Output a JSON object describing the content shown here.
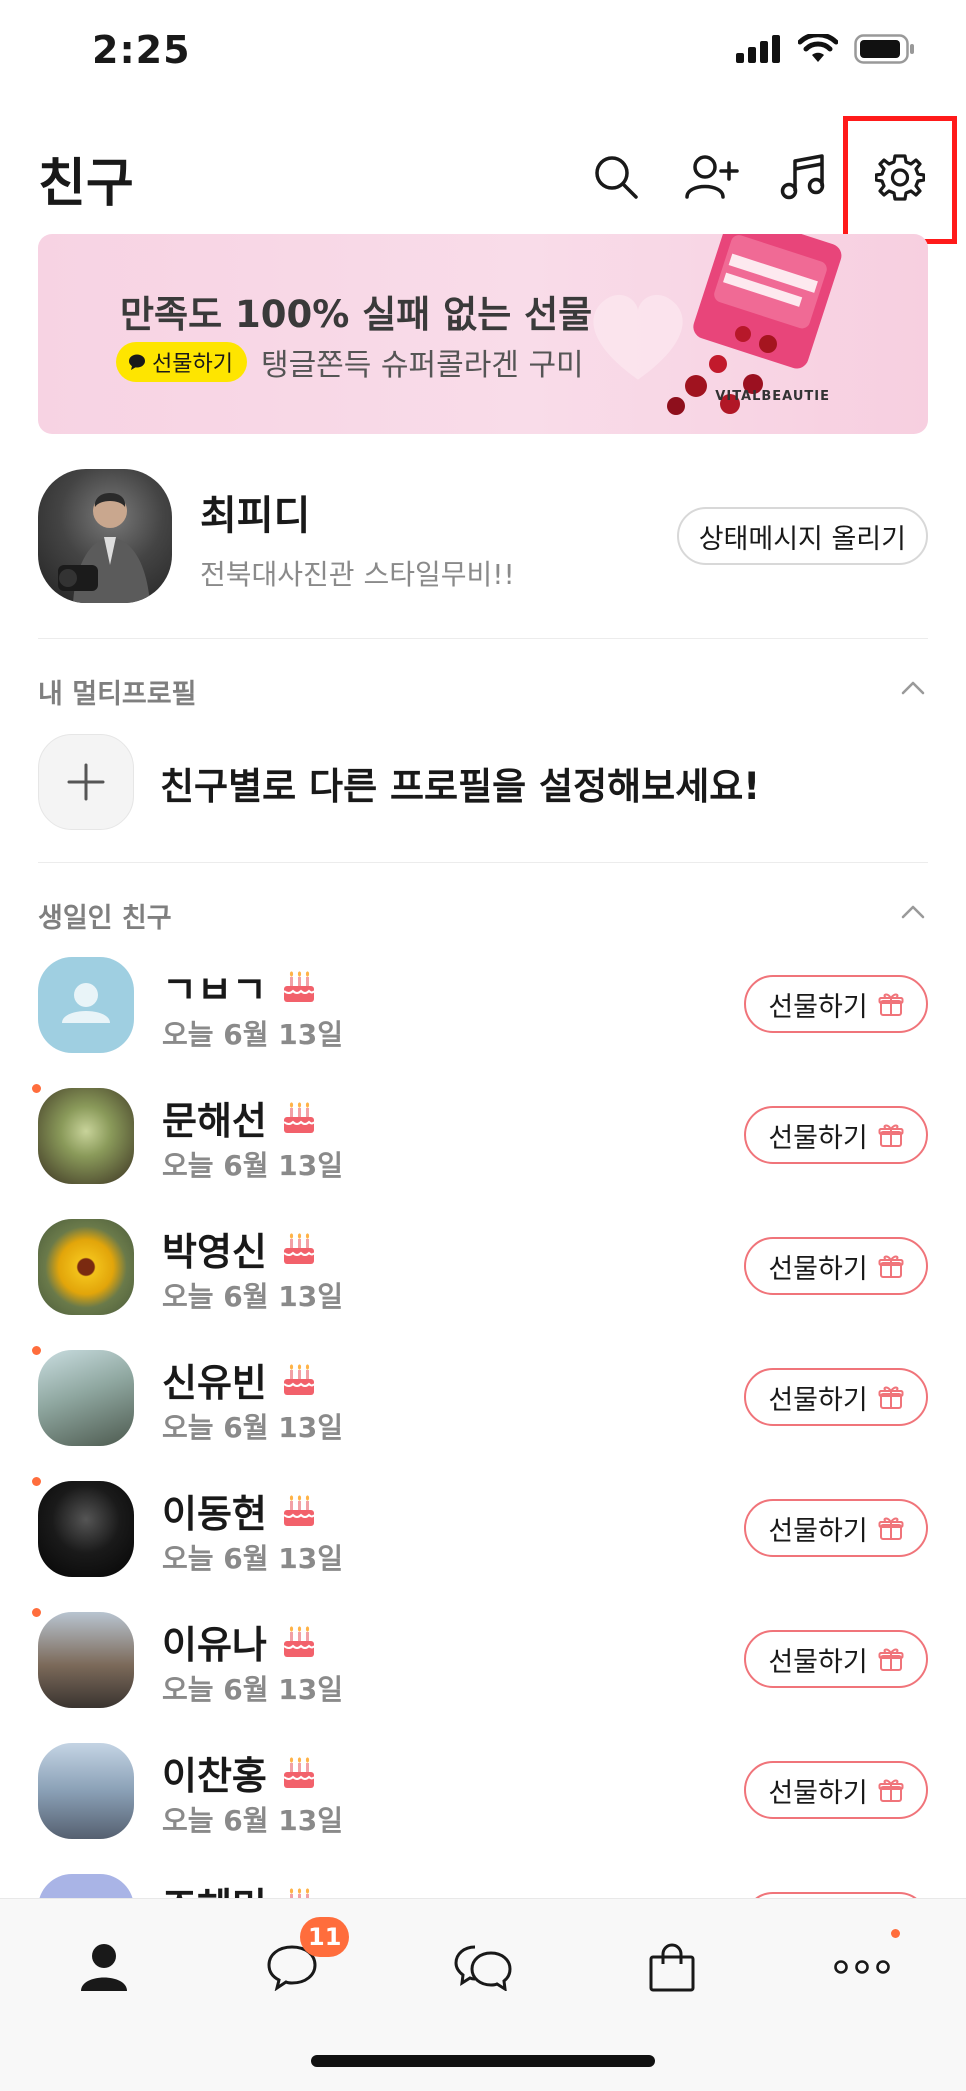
{
  "status_bar": {
    "time": "2:25"
  },
  "header": {
    "title": "친구",
    "icons": [
      "search-icon",
      "add-friend-icon",
      "music-icon",
      "settings-icon"
    ]
  },
  "banner": {
    "title": "만족도 100% 실패 없는 선물",
    "chip_label": "선물하기",
    "subtitle": "탱글쫀득 슈퍼콜라겐 구미",
    "brand": "VITALBEAUTIE"
  },
  "my_profile": {
    "name": "최피디",
    "status_message": "전북대사진관 스타일무비!!",
    "status_button": "상태메시지 올리기"
  },
  "multi_profile": {
    "section_label": "내 멀티프로필",
    "cta": "친구별로 다른 프로필을 설정해보세요!"
  },
  "birthday": {
    "section_label": "생일인 친구",
    "gift_label": "선물하기",
    "friends": [
      {
        "name": "ㄱㅂㄱ",
        "date": "오늘 6월 13일",
        "new": false
      },
      {
        "name": "문해선",
        "date": "오늘 6월 13일",
        "new": true
      },
      {
        "name": "박영신",
        "date": "오늘 6월 13일",
        "new": false
      },
      {
        "name": "신유빈",
        "date": "오늘 6월 13일",
        "new": true
      },
      {
        "name": "이동현",
        "date": "오늘 6월 13일",
        "new": true
      },
      {
        "name": "이유나",
        "date": "오늘 6월 13일",
        "new": true
      },
      {
        "name": "이찬홍",
        "date": "오늘 6월 13일",
        "new": false
      },
      {
        "name": "조혜민",
        "date": "",
        "new": false
      }
    ]
  },
  "bottom_nav": {
    "items": [
      "friends-tab",
      "chats-tab",
      "openchat-tab",
      "shopping-tab",
      "more-tab"
    ],
    "chat_badge": "11"
  },
  "colors": {
    "accent_orange": "#ff6d3c",
    "gift_border": "#f0747a",
    "chip_yellow": "#fee500",
    "highlight_red": "#ff1a1a"
  }
}
